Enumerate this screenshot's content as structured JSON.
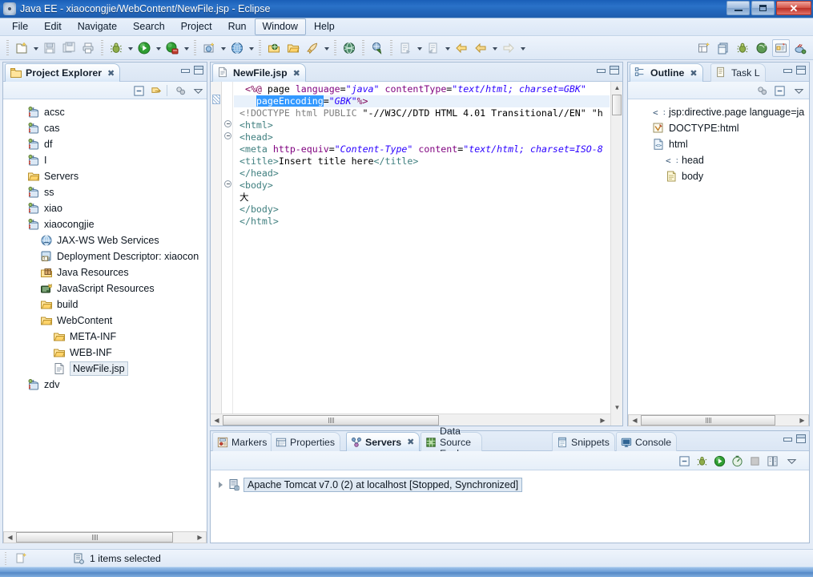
{
  "window": {
    "title": "Java EE - xiaocongjie/WebContent/NewFile.jsp - Eclipse",
    "icon": "eclipse-icon",
    "minimize_label": "Minimize",
    "maximize_label": "Maximize",
    "close_label": "Close"
  },
  "menubar": {
    "items": [
      {
        "label": "File",
        "active": false
      },
      {
        "label": "Edit",
        "active": false
      },
      {
        "label": "Navigate",
        "active": false
      },
      {
        "label": "Search",
        "active": false
      },
      {
        "label": "Project",
        "active": false
      },
      {
        "label": "Run",
        "active": false
      },
      {
        "label": "Window",
        "active": true
      },
      {
        "label": "Help",
        "active": false
      }
    ]
  },
  "toolbar": {
    "groups": [
      {
        "buttons": [
          {
            "icon": "new-wizard-icon",
            "dropdown": true
          },
          {
            "icon": "save-icon",
            "dropdown": false
          },
          {
            "icon": "save-all-icon",
            "dropdown": false
          },
          {
            "icon": "print-icon",
            "dropdown": false
          }
        ]
      },
      {
        "buttons": [
          {
            "icon": "debug-icon",
            "dropdown": true
          },
          {
            "icon": "run-icon",
            "dropdown": true
          },
          {
            "icon": "run-server-icon",
            "dropdown": true
          }
        ]
      },
      {
        "buttons": [
          {
            "icon": "new-java-ee-icon",
            "dropdown": true
          },
          {
            "icon": "search-web-icon",
            "dropdown": true
          }
        ]
      },
      {
        "buttons": [
          {
            "icon": "open-package-icon",
            "dropdown": false
          },
          {
            "icon": "open-folder-icon",
            "dropdown": false
          },
          {
            "icon": "quick-access-icon",
            "dropdown": true
          }
        ]
      },
      {
        "buttons": [
          {
            "icon": "globe-icon",
            "dropdown": false
          }
        ]
      },
      {
        "buttons": [
          {
            "icon": "open-browser-icon",
            "dropdown": false
          }
        ]
      },
      {
        "buttons": [
          {
            "icon": "next-annotation-icon",
            "dropdown": true
          },
          {
            "icon": "prev-annotation-icon",
            "dropdown": true
          },
          {
            "icon": "back-arrow-icon",
            "dropdown": false
          },
          {
            "icon": "forward-arrow-icon",
            "dropdown": true
          },
          {
            "icon": "forward-grey-icon",
            "dropdown": true
          }
        ]
      }
    ],
    "perspective_buttons": [
      {
        "icon": "new-perspective-icon",
        "selected": false
      },
      {
        "icon": "open-perspective-icon",
        "selected": false
      },
      {
        "icon": "debug-perspective-icon",
        "selected": false
      },
      {
        "icon": "java-browsing-icon",
        "selected": false
      },
      {
        "icon": "java-ee-perspective-icon",
        "selected": true
      },
      {
        "icon": "java-perspective-icon",
        "selected": false
      }
    ]
  },
  "project_explorer": {
    "tab_label": "Project Explorer",
    "tab_icon": "project-explorer-icon",
    "close_label": "✖",
    "tools": [
      {
        "icon": "collapse-all-icon"
      },
      {
        "icon": "link-with-editor-icon"
      },
      {
        "icon": "view-menu-filters-icon"
      },
      {
        "icon": "view-menu-icon"
      }
    ],
    "tree": [
      {
        "label": "acsc",
        "icon": "java-project-icon",
        "indent": 0,
        "selected": false
      },
      {
        "label": "cas",
        "icon": "java-project-icon",
        "indent": 0,
        "selected": false
      },
      {
        "label": "df",
        "icon": "java-project-icon",
        "indent": 0,
        "selected": false
      },
      {
        "label": "I",
        "icon": "java-project-icon",
        "indent": 0,
        "selected": false
      },
      {
        "label": "Servers",
        "icon": "folder-icon",
        "indent": 0,
        "selected": false
      },
      {
        "label": "ss",
        "icon": "java-project-icon",
        "indent": 0,
        "selected": false
      },
      {
        "label": "xiao",
        "icon": "java-project-icon",
        "indent": 0,
        "selected": false
      },
      {
        "label": "xiaocongjie",
        "icon": "java-project-icon",
        "indent": 0,
        "selected": false
      },
      {
        "label": "JAX-WS Web Services",
        "icon": "jaxws-icon",
        "indent": 1,
        "selected": false
      },
      {
        "label": "Deployment Descriptor: xiaocon",
        "icon": "deployment-descriptor-icon",
        "indent": 1,
        "selected": false
      },
      {
        "label": "Java Resources",
        "icon": "java-resources-icon",
        "indent": 1,
        "selected": false
      },
      {
        "label": "JavaScript Resources",
        "icon": "javascript-resources-icon",
        "indent": 1,
        "selected": false
      },
      {
        "label": "build",
        "icon": "folder-icon",
        "indent": 1,
        "selected": false
      },
      {
        "label": "WebContent",
        "icon": "folder-icon",
        "indent": 1,
        "selected": false
      },
      {
        "label": "META-INF",
        "icon": "folder-icon",
        "indent": 2,
        "selected": false
      },
      {
        "label": "WEB-INF",
        "icon": "folder-icon",
        "indent": 2,
        "selected": false
      },
      {
        "label": "NewFile.jsp",
        "icon": "jsp-file-icon",
        "indent": 2,
        "selected": true
      },
      {
        "label": "zdv",
        "icon": "java-project-icon",
        "indent": 0,
        "selected": false
      }
    ]
  },
  "editor": {
    "tab_label": "NewFile.jsp",
    "tab_icon": "jsp-file-icon",
    "close_label": "✖",
    "selection_text": "pageEncoding",
    "lines": [
      {
        "n": 1,
        "highlight": false,
        "segments": [
          {
            "t": "  ",
            "c": "txt"
          },
          {
            "t": "<%@",
            "c": "dir"
          },
          {
            "t": " page ",
            "c": "txt"
          },
          {
            "t": "language",
            "c": "attr"
          },
          {
            "t": "=",
            "c": "txt"
          },
          {
            "t": "\"java\"",
            "c": "val"
          },
          {
            "t": " ",
            "c": "txt"
          },
          {
            "t": "contentType",
            "c": "attr"
          },
          {
            "t": "=",
            "c": "txt"
          },
          {
            "t": "\"text/html; charset=GBK\"",
            "c": "val"
          }
        ]
      },
      {
        "n": 2,
        "highlight": true,
        "segments": [
          {
            "t": "    ",
            "c": "txt"
          },
          {
            "t": "pageEncoding",
            "c": "selhl"
          },
          {
            "t": "=",
            "c": "txt"
          },
          {
            "t": "\"GBK\"",
            "c": "val"
          },
          {
            "t": "%>",
            "c": "dir"
          }
        ]
      },
      {
        "n": 3,
        "highlight": false,
        "segments": [
          {
            "t": " ",
            "c": "txt"
          },
          {
            "t": "<!DOCTYPE html PUBLIC ",
            "c": "dt"
          },
          {
            "t": "\"-//W3C//DTD HTML 4.01 Transitional//EN\"",
            "c": "txt"
          },
          {
            "t": " \"h",
            "c": "txt"
          }
        ]
      },
      {
        "n": 4,
        "highlight": false,
        "segments": [
          {
            "t": " ",
            "c": "txt"
          },
          {
            "t": "<html>",
            "c": "tag"
          }
        ]
      },
      {
        "n": 5,
        "highlight": false,
        "segments": [
          {
            "t": " ",
            "c": "txt"
          },
          {
            "t": "<head>",
            "c": "tag"
          }
        ]
      },
      {
        "n": 6,
        "highlight": false,
        "segments": [
          {
            "t": " ",
            "c": "txt"
          },
          {
            "t": "<meta ",
            "c": "tag"
          },
          {
            "t": "http-equiv",
            "c": "attr"
          },
          {
            "t": "=",
            "c": "txt"
          },
          {
            "t": "\"Content-Type\"",
            "c": "val"
          },
          {
            "t": " ",
            "c": "txt"
          },
          {
            "t": "content",
            "c": "attr"
          },
          {
            "t": "=",
            "c": "txt"
          },
          {
            "t": "\"text/html; charset=ISO-8",
            "c": "val"
          }
        ]
      },
      {
        "n": 7,
        "highlight": false,
        "segments": [
          {
            "t": " ",
            "c": "txt"
          },
          {
            "t": "<title>",
            "c": "tag"
          },
          {
            "t": "Insert title here",
            "c": "txt"
          },
          {
            "t": "</title>",
            "c": "tag"
          }
        ]
      },
      {
        "n": 8,
        "highlight": false,
        "segments": [
          {
            "t": " ",
            "c": "txt"
          },
          {
            "t": "</head>",
            "c": "tag"
          }
        ]
      },
      {
        "n": 9,
        "highlight": false,
        "segments": [
          {
            "t": " ",
            "c": "txt"
          },
          {
            "t": "<body>",
            "c": "tag"
          }
        ]
      },
      {
        "n": 10,
        "highlight": false,
        "segments": [
          {
            "t": " 大",
            "c": "txt"
          }
        ]
      },
      {
        "n": 11,
        "highlight": false,
        "segments": [
          {
            "t": " ",
            "c": "txt"
          },
          {
            "t": "</body>",
            "c": "tag"
          }
        ]
      },
      {
        "n": 12,
        "highlight": false,
        "segments": [
          {
            "t": " ",
            "c": "txt"
          },
          {
            "t": "</html>",
            "c": "tag"
          }
        ]
      }
    ]
  },
  "outline": {
    "tab_label": "Outline",
    "tab_icon": "outline-icon",
    "close_label": "✖",
    "sibling_tab_label": "Task L",
    "sibling_tab_icon": "task-list-icon",
    "tools": [
      {
        "icon": "sort-filter-icon"
      },
      {
        "icon": "collapse-all-icon"
      },
      {
        "icon": "view-menu-icon"
      }
    ],
    "tree": [
      {
        "label": "jsp:directive.page language=ja",
        "icon": "element-icon",
        "indent": 0
      },
      {
        "label": "DOCTYPE:html",
        "icon": "doctype-icon",
        "indent": 0
      },
      {
        "label": "html",
        "icon": "html-element-icon",
        "indent": 0
      },
      {
        "label": "head",
        "icon": "element-icon",
        "indent": 1
      },
      {
        "label": "body",
        "icon": "body-element-icon",
        "indent": 1
      }
    ]
  },
  "bottom_panel": {
    "tabs": [
      {
        "label": "Markers",
        "icon": "markers-icon",
        "selected": false
      },
      {
        "label": "Properties",
        "icon": "properties-icon",
        "selected": false
      },
      {
        "label": "Servers",
        "icon": "servers-icon",
        "selected": true,
        "closeable": true
      },
      {
        "label": "Data Source Explorer",
        "icon": "data-source-icon",
        "selected": false
      },
      {
        "label": "Snippets",
        "icon": "snippets-icon",
        "selected": false
      },
      {
        "label": "Console",
        "icon": "console-icon",
        "selected": false
      }
    ],
    "tools": [
      {
        "icon": "collapse-all-icon"
      },
      {
        "icon": "debug-server-icon"
      },
      {
        "icon": "start-server-icon"
      },
      {
        "icon": "profile-server-icon"
      },
      {
        "icon": "stop-server-icon"
      },
      {
        "icon": "publish-icon"
      },
      {
        "icon": "view-menu-icon"
      }
    ],
    "servers": [
      {
        "label": "Apache Tomcat v7.0 (2) at localhost  [Stopped, Synchronized]",
        "icon": "server-icon",
        "selected": true
      }
    ]
  },
  "statusbar": {
    "left_icon": "new-item-icon",
    "selection_icon": "server-icon",
    "text": "1 items selected"
  }
}
